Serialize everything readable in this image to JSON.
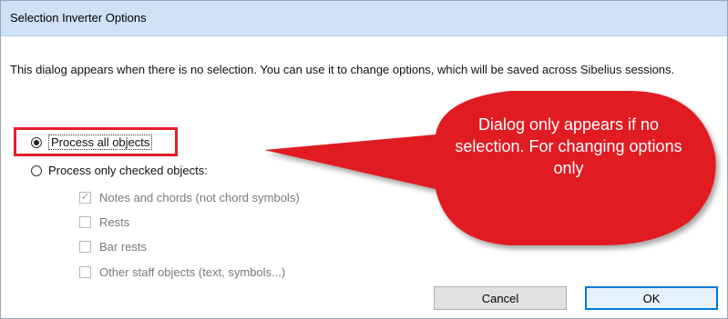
{
  "window": {
    "title": "Selection Inverter Options"
  },
  "description": "This dialog appears when there is no selection. You can use it to change options, which will be saved across Sibelius sessions.",
  "options": {
    "process_all": "Process all objects",
    "process_checked": "Process only checked objects:"
  },
  "checkboxes": [
    {
      "label": "Notes and chords (not chord symbols)",
      "checked": true
    },
    {
      "label": "Rests",
      "checked": false
    },
    {
      "label": "Bar rests",
      "checked": false
    },
    {
      "label": "Other staff objects (text, symbols...)",
      "checked": false
    }
  ],
  "buttons": {
    "cancel": "Cancel",
    "ok": "OK"
  },
  "callout": {
    "text": "Dialog only appears if no selection. For changing options only",
    "color": "#e01b24",
    "highlight_color": "#e0202a"
  },
  "colors": {
    "titlebar": "#cfe1f5",
    "accent": "#0078d7"
  }
}
